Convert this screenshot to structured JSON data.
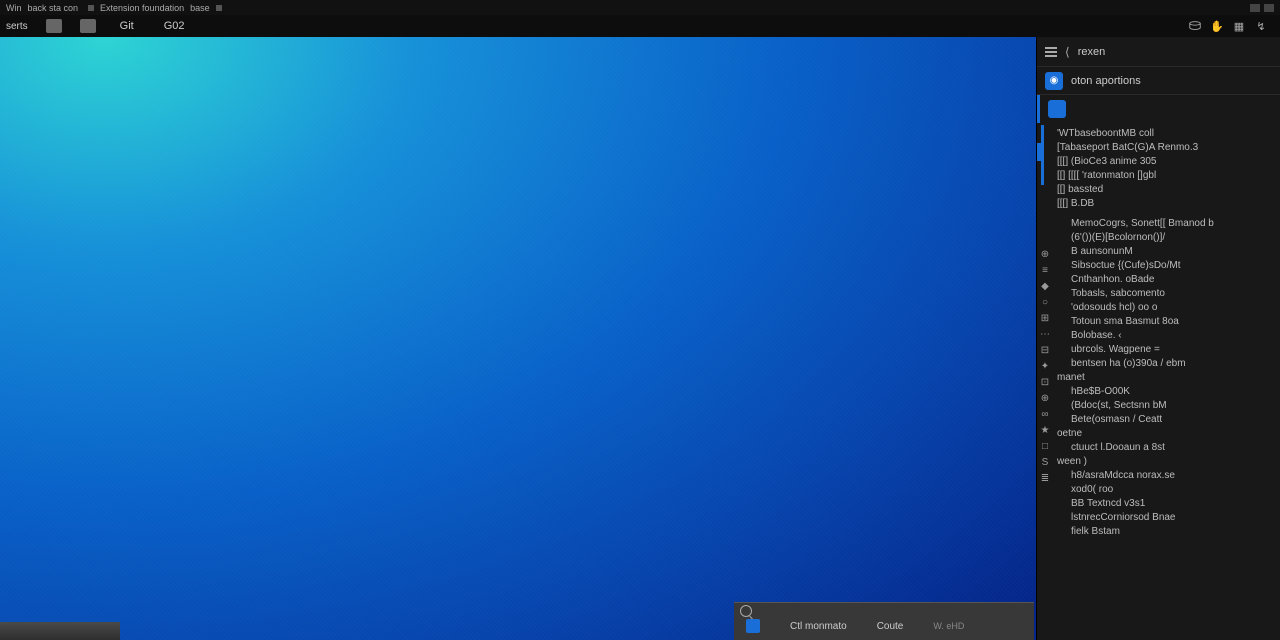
{
  "titlebar": {
    "left1": "Win",
    "left2": "back sta con",
    "center": "Extension foundation",
    "center2": "base"
  },
  "tabs": {
    "tab1": "Git",
    "tab2": "G02"
  },
  "panel": {
    "title": "rexen",
    "category": "oton aportions",
    "lines": [
      "'WTbaseboontMB coll",
      "[Tabaseport  BatC(G)A  Renmo.3",
      "[[[] (BioCe3 anime  305",
      "[[] [[[[ 'ratonmaton []gbl",
      "[[] bassted",
      "[[[] B.DB"
    ],
    "code": [
      "MemoCogrs,  Sonett[[ Bmanod  b",
      "(6'())(E)[Bcolornon()]/",
      "B aunsonunM",
      "Sibsoctue  {(Cufe)sDo/Mt",
      "Cnthanhon.  oBade",
      "Tobasls,  sabcomento",
      "'odosouds  hcl)  oo  o",
      "Totoun  sma  Basmut  8oa",
      "Bolobase.  ‹",
      "ubrcols. Wagpene  =",
      "bentsen   ha  (o)390a /  ebm",
      "manet",
      "hBe$B-O00K",
      "(Bdoc(st,  Sectsnn  bM",
      "Bete(osmasn /  Ceatt",
      "oetne",
      "ctuuct   l.Dooaun a  8st",
      "ween                    )",
      "h8/asraMdcca   norax.se",
      "xod0(     roo",
      "BB   Textncd v3s1",
      "lstnrecCorniorsod   Bnae",
      "fielk        Bstam"
    ],
    "icons": [
      "⊕",
      "≡",
      "◆",
      "○",
      "⊞",
      "⋯",
      "⊟",
      "✦",
      "⊡",
      "⊕",
      "∞",
      "★",
      "□",
      "S",
      "≣"
    ]
  },
  "search": {
    "label": "Ctl monmato",
    "sub": "Coute",
    "meta": "W. eHD"
  }
}
